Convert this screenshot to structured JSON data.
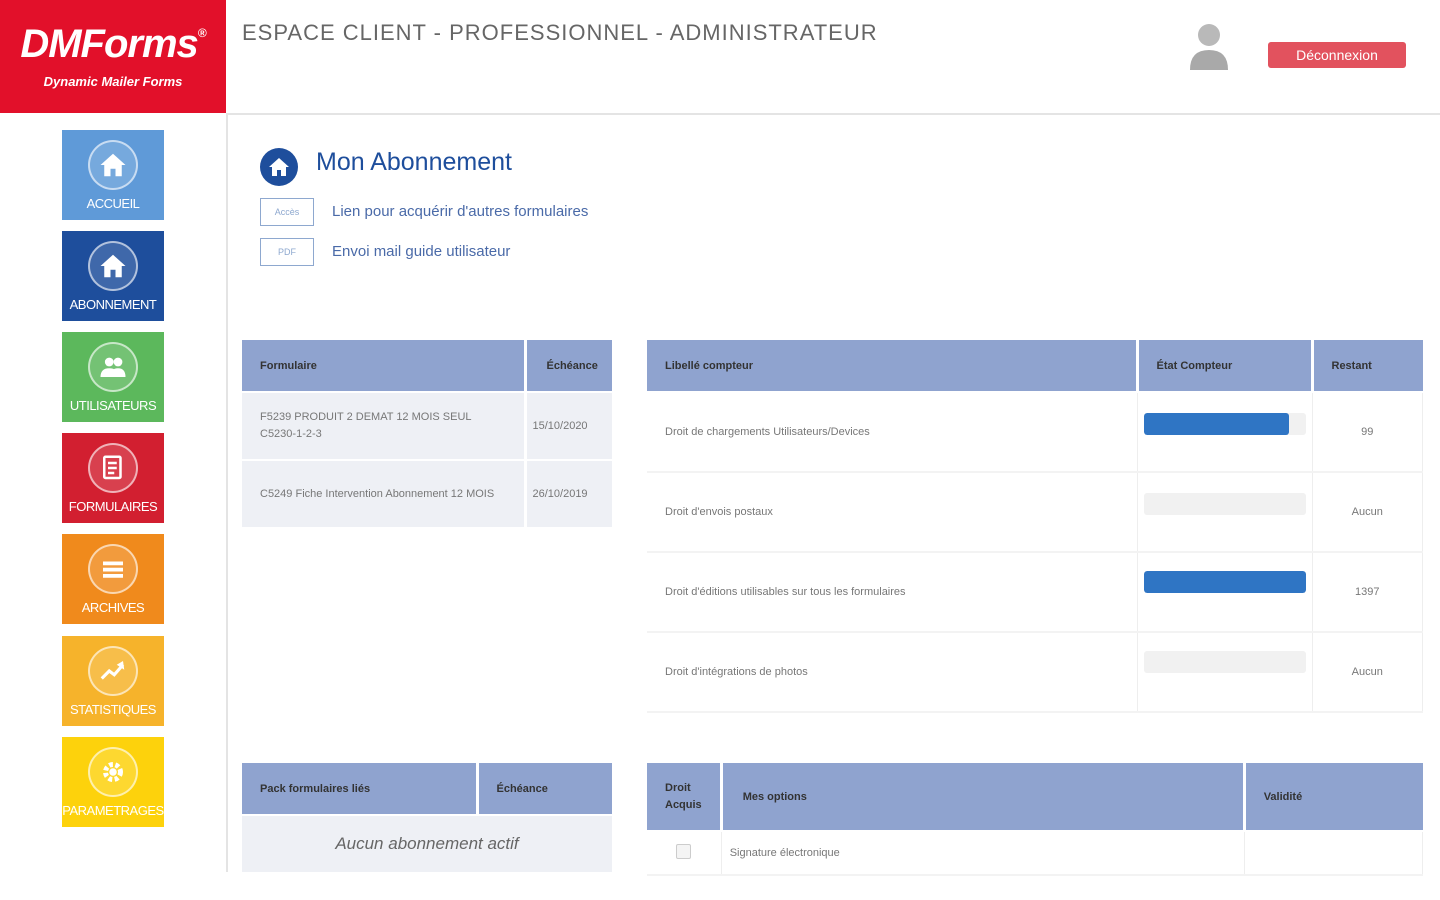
{
  "brand": {
    "name": "DMForms",
    "mark": "®",
    "tagline": "Dynamic Mailer Forms",
    "color": "#e2102a"
  },
  "header": {
    "title": "ESPACE CLIENT - PROFESSIONNEL - ADMINISTRATEUR",
    "logout_label": "Déconnexion"
  },
  "sidebar": {
    "items": [
      {
        "label": "ACCUEIL",
        "icon": "home-icon",
        "color": "#5f9ad8"
      },
      {
        "label": "ABONNEMENT",
        "icon": "home-icon",
        "color": "#1e4e9c"
      },
      {
        "label": "UTILISATEURS",
        "icon": "users-icon",
        "color": "#5cb85c"
      },
      {
        "label": "FORMULAIRES",
        "icon": "document-icon",
        "color": "#d21f30"
      },
      {
        "label": "ARCHIVES",
        "icon": "list-icon",
        "color": "#f08a1c"
      },
      {
        "label": "STATISTIQUES",
        "icon": "trend-icon",
        "color": "#f6b32b"
      },
      {
        "label": "PARAMETRAGES",
        "icon": "gear-icon",
        "color": "#fdd20c"
      }
    ]
  },
  "main": {
    "title": "Mon Abonnement",
    "links": [
      {
        "tag": "Accès",
        "text": "Lien pour acquérir d'autres formulaires"
      },
      {
        "tag": "PDF",
        "text": "Envoi mail guide utilisateur"
      }
    ],
    "forms_table": {
      "headers": [
        "Formulaire",
        "Échéance"
      ],
      "rows": [
        [
          "F5239 PRODUIT 2 DEMAT 12 MOIS SEUL C5230-1-2-3",
          "15/10/2020"
        ],
        [
          "C5249 Fiche Intervention Abonnement 12 MOIS",
          "26/10/2019"
        ]
      ]
    },
    "counters_table": {
      "headers": [
        "Libellé compteur",
        "État Compteur",
        "Restant"
      ],
      "rows": [
        {
          "label": "Droit de chargements Utilisateurs/Devices",
          "fill": 0.9,
          "remaining": "99"
        },
        {
          "label": "Droit d'envois postaux",
          "fill": 0,
          "remaining": "Aucun"
        },
        {
          "label": "Droit d'éditions utilisables sur tous les formulaires",
          "fill": 1.0,
          "remaining": "1397"
        },
        {
          "label": "Droit d'intégrations de photos",
          "fill": 0,
          "remaining": "Aucun"
        }
      ]
    },
    "pack_table": {
      "headers": [
        "Pack formulaires liés",
        "Échéance"
      ],
      "empty_message": "Aucun abonnement actif"
    },
    "options_table": {
      "headers": [
        "Droit Acquis",
        "Mes options",
        "Validité"
      ],
      "rows": [
        {
          "checked": false,
          "label": "Signature électronique",
          "validity": ""
        }
      ]
    }
  }
}
